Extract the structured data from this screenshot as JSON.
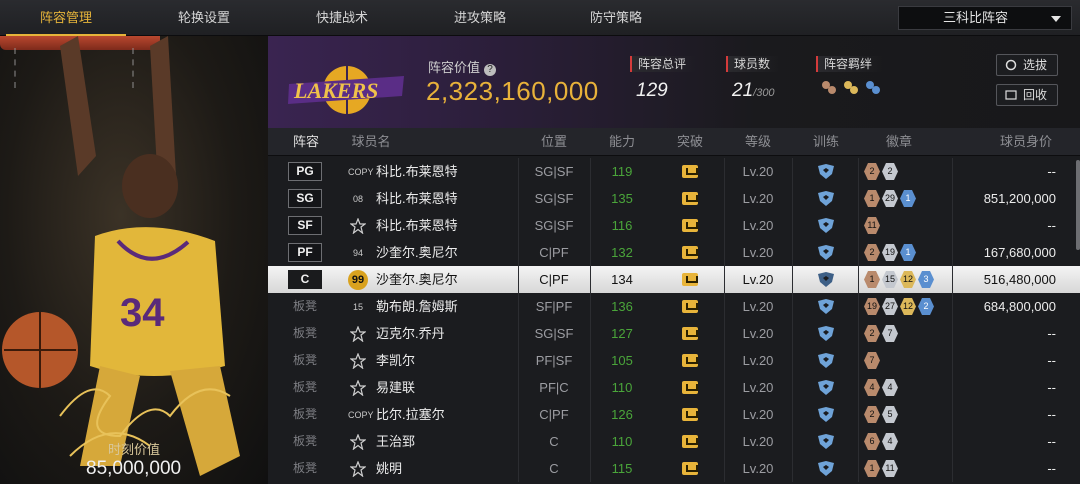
{
  "nav": {
    "tabs": [
      "阵容管理",
      "轮换设置",
      "快捷战术",
      "进攻策略",
      "防守策略"
    ],
    "active_tab": 0,
    "lineup_select": "三科比阵容"
  },
  "left_panel": {
    "moment_value_label": "时刻价值",
    "moment_value": "85,000,000"
  },
  "header": {
    "lineup_value_label": "阵容价值",
    "lineup_value": "2,323,160,000",
    "rating_label": "阵容总评",
    "rating_value": "129",
    "players_label": "球员数",
    "players_value": "21",
    "players_max": "/300",
    "bond_label": "阵容羁绊",
    "select_button": "选拔",
    "recycle_button": "回收"
  },
  "table": {
    "headers": [
      "阵容",
      "球员名",
      "位置",
      "能力",
      "突破",
      "等级",
      "训练",
      "徽章",
      "球员身价"
    ],
    "rows": [
      {
        "slot": "PG",
        "bench": false,
        "jersey": "COPY",
        "name": "科比.布莱恩特",
        "position": "SG|SF",
        "ability": "119",
        "level": "Lv.20",
        "badges": [
          [
            "2",
            "bronze"
          ],
          [
            "2",
            "silver"
          ]
        ],
        "value": "--"
      },
      {
        "slot": "SG",
        "bench": false,
        "jersey": "08",
        "name": "科比.布莱恩特",
        "position": "SG|SF",
        "ability": "135",
        "level": "Lv.20",
        "badges": [
          [
            "1",
            "bronze"
          ],
          [
            "29",
            "silver"
          ],
          [
            "1",
            "blue"
          ]
        ],
        "value": "851,200,000"
      },
      {
        "slot": "SF",
        "bench": false,
        "jersey": "star",
        "name": "科比.布莱恩特",
        "position": "SG|SF",
        "ability": "116",
        "level": "Lv.20",
        "badges": [
          [
            "11",
            "bronze"
          ]
        ],
        "value": "--"
      },
      {
        "slot": "PF",
        "bench": false,
        "jersey": "94",
        "name": "沙奎尔.奥尼尔",
        "position": "C|PF",
        "ability": "132",
        "level": "Lv.20",
        "badges": [
          [
            "2",
            "bronze"
          ],
          [
            "19",
            "silver"
          ],
          [
            "1",
            "blue"
          ]
        ],
        "value": "167,680,000"
      },
      {
        "slot": "C",
        "bench": false,
        "selected": true,
        "jersey": "99",
        "name": "沙奎尔.奥尼尔",
        "position": "C|PF",
        "ability": "134",
        "level": "Lv.20",
        "badges": [
          [
            "1",
            "bronze"
          ],
          [
            "15",
            "silver"
          ],
          [
            "12",
            "gold"
          ],
          [
            "3",
            "blue"
          ]
        ],
        "value": "516,480,000"
      },
      {
        "slot": "板凳",
        "bench": true,
        "jersey": "15",
        "name": "勒布朗.詹姆斯",
        "position": "SF|PF",
        "ability": "136",
        "level": "Lv.20",
        "badges": [
          [
            "19",
            "bronze"
          ],
          [
            "27",
            "silver"
          ],
          [
            "12",
            "gold"
          ],
          [
            "2",
            "blue"
          ]
        ],
        "value": "684,800,000"
      },
      {
        "slot": "板凳",
        "bench": true,
        "jersey": "star",
        "name": "迈克尔.乔丹",
        "position": "SG|SF",
        "ability": "127",
        "level": "Lv.20",
        "badges": [
          [
            "2",
            "bronze"
          ],
          [
            "7",
            "silver"
          ]
        ],
        "value": "--"
      },
      {
        "slot": "板凳",
        "bench": true,
        "jersey": "star",
        "name": "李凯尔",
        "position": "PF|SF",
        "ability": "105",
        "level": "Lv.20",
        "badges": [
          [
            "7",
            "bronze"
          ]
        ],
        "value": "--"
      },
      {
        "slot": "板凳",
        "bench": true,
        "jersey": "star",
        "name": "易建联",
        "position": "PF|C",
        "ability": "110",
        "level": "Lv.20",
        "badges": [
          [
            "4",
            "bronze"
          ],
          [
            "4",
            "silver"
          ]
        ],
        "value": "--"
      },
      {
        "slot": "板凳",
        "bench": true,
        "jersey": "COPY",
        "name": "比尔.拉塞尔",
        "position": "C|PF",
        "ability": "126",
        "level": "Lv.20",
        "badges": [
          [
            "2",
            "bronze"
          ],
          [
            "5",
            "silver"
          ]
        ],
        "value": "--"
      },
      {
        "slot": "板凳",
        "bench": true,
        "jersey": "star",
        "name": "王治郅",
        "position": "C",
        "ability": "110",
        "level": "Lv.20",
        "badges": [
          [
            "6",
            "bronze"
          ],
          [
            "4",
            "silver"
          ]
        ],
        "value": "--"
      },
      {
        "slot": "板凳",
        "bench": true,
        "jersey": "star",
        "name": "姚明",
        "position": "C",
        "ability": "115",
        "level": "Lv.20",
        "badges": [
          [
            "1",
            "bronze"
          ],
          [
            "11",
            "silver"
          ]
        ],
        "value": "--"
      }
    ]
  },
  "colors": {
    "accent": "#e6b43a",
    "ability_green": "#4aa53a",
    "lakers_purple": "#552583"
  }
}
